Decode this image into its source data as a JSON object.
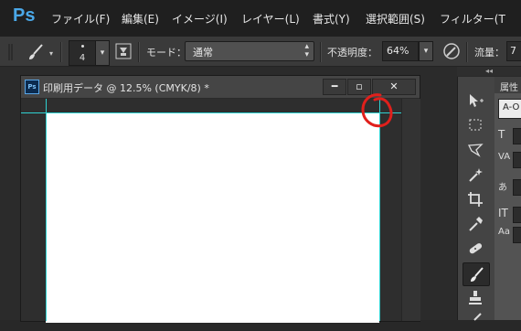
{
  "app": {
    "logo": "Ps"
  },
  "menu": [
    "ファイル(F)",
    "編集(E)",
    "イメージ(I)",
    "レイヤー(L)",
    "書式(Y)",
    "選択範囲(S)",
    "フィルター(T"
  ],
  "options": {
    "brush_size": "4",
    "mode_label": "モード：",
    "mode_value": "通常",
    "opacity_label": "不透明度：",
    "opacity_value": "64%",
    "flow_label": "流量：",
    "flow_value": "7"
  },
  "document": {
    "title": "印刷用データ @ 12.5% (CMYK/8) *",
    "icon_text": "Ps",
    "minimize": "━",
    "maximize": "▫",
    "close": "✕"
  },
  "panel": {
    "collapse": "◂◂",
    "properties_title": "属性",
    "font_value": "A-O"
  },
  "tools": [
    "move-tool",
    "marquee-tool",
    "lasso-tool",
    "magic-wand-tool",
    "crop-tool",
    "eyedropper-tool",
    "healing-brush-tool",
    "brush-tool",
    "clone-stamp-tool",
    "history-brush-tool"
  ],
  "colors": {
    "accent": "#4aa8e8",
    "guide": "#2fd1d1",
    "annotation": "#e0201c",
    "canvas": "#ffffff"
  }
}
